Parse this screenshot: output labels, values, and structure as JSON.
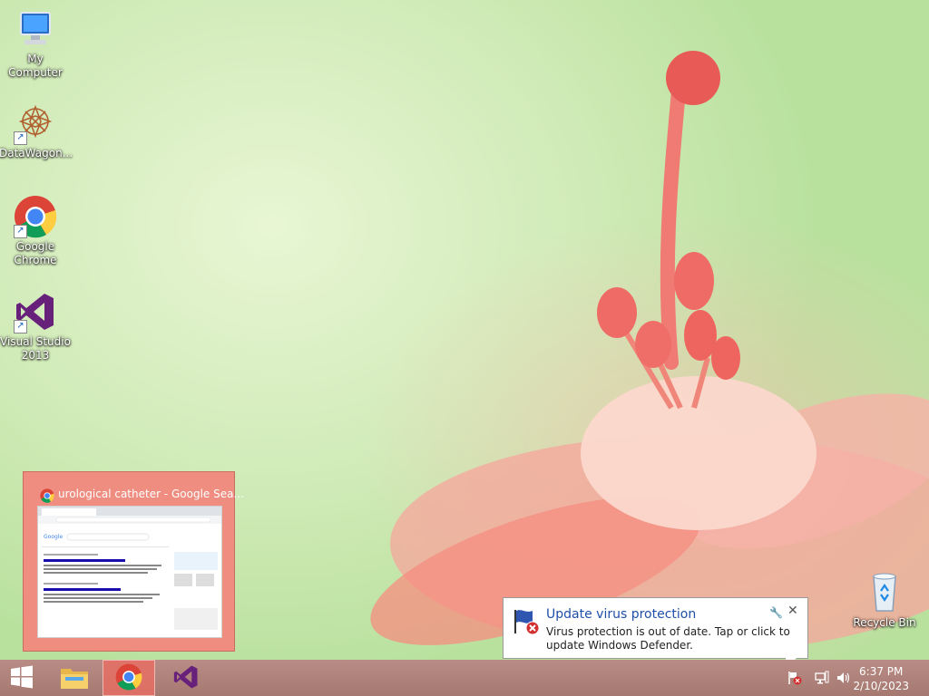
{
  "desktop": {
    "icons": [
      {
        "label": "My Computer",
        "icon": "my-computer-icon"
      },
      {
        "label": "DataWagon...",
        "icon": "datawagon-icon"
      },
      {
        "label": "Google Chrome",
        "icon": "chrome-icon"
      },
      {
        "label": "Visual Studio 2013",
        "icon": "visual-studio-icon"
      }
    ],
    "recycle_bin": {
      "label": "Recycle Bin",
      "icon": "recycle-bin-icon"
    }
  },
  "thumbnail": {
    "title": "urological catheter - Google Sea...",
    "icon": "chrome-icon"
  },
  "notification": {
    "title": "Update virus protection",
    "body": "Virus protection is out of date. Tap or click to update Windows Defender.",
    "icon": "windows-defender-flag-icon"
  },
  "taskbar": {
    "items": [
      "start-icon",
      "file-explorer-icon",
      "chrome-icon",
      "visual-studio-icon"
    ],
    "clock": {
      "time": "6:37 PM",
      "date": "2/10/2023"
    }
  },
  "colors": {
    "taskbar": "#a57870",
    "active_item": "#ee8d80",
    "toast_title": "#1f4fa8"
  }
}
